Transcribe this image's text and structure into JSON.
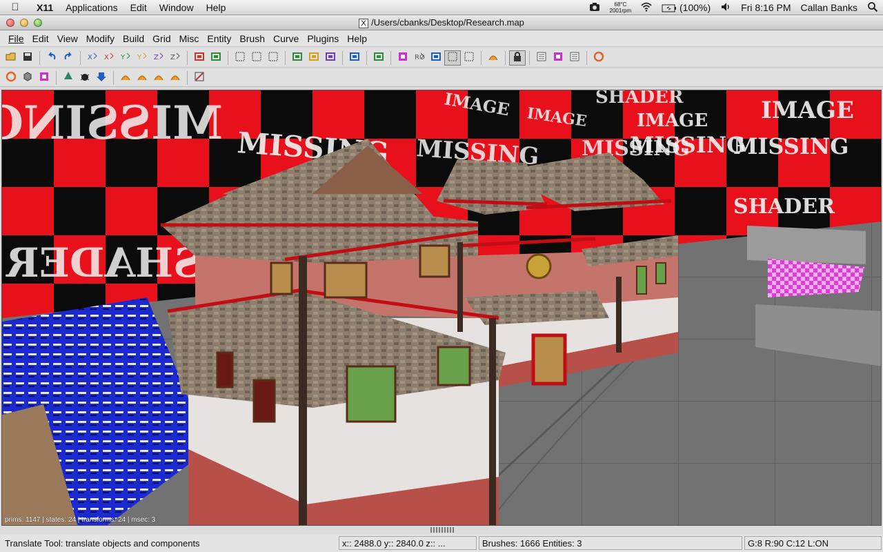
{
  "macos_menubar": {
    "app_name": "X11",
    "items": [
      "Applications",
      "Edit",
      "Window",
      "Help"
    ],
    "temperature": "68°C",
    "fan": "2001rpm",
    "battery": "(100%)",
    "clock": "Fri 8:16 PM",
    "user": "Callan Banks"
  },
  "window": {
    "title": "/Users/cbanks/Desktop/Research.map"
  },
  "menu": [
    {
      "label": "File"
    },
    {
      "label": "Edit"
    },
    {
      "label": "View"
    },
    {
      "label": "Modify"
    },
    {
      "label": "Build"
    },
    {
      "label": "Grid"
    },
    {
      "label": "Misc"
    },
    {
      "label": "Entity"
    },
    {
      "label": "Brush"
    },
    {
      "label": "Curve"
    },
    {
      "label": "Plugins"
    },
    {
      "label": "Help"
    }
  ],
  "toolbar1_icons": [
    "open-icon",
    "save-icon",
    "|",
    "undo-icon",
    "redo-icon",
    "|",
    "flip-x-icon",
    "rotate-x-icon",
    "flip-y-icon",
    "rotate-y-icon",
    "flip-z-icon",
    "rotate-z-icon",
    "|",
    "csg-subtract-icon",
    "csg-merge-icon",
    "|",
    "select-inside-icon",
    "select-touching-icon",
    "select-complete-icon",
    "|",
    "hollow-icon",
    "csg-make-room-icon",
    "clipper-green-icon",
    "|",
    "view-change-icon",
    "|",
    "clipper-icon",
    "|",
    "texture-lock-icon",
    "camera-rotate-icon",
    "scale-icon",
    "select-drag-icon",
    "resize-icon",
    "|",
    "patch-icon",
    "|",
    "lock-icon",
    "|",
    "entity-list-icon",
    "texture-browser-icon",
    "surface-inspector-icon",
    "|",
    "refresh-icon"
  ],
  "toolbar2_icons": [
    "refresh-models-icon",
    "cube-icon",
    "texture-icon",
    "|",
    "tree-icon",
    "bug-icon",
    "arrow-down-icon",
    "|",
    "patch-cap-icon",
    "patch-bevel-icon",
    "patch-cylinder-icon",
    "patch-endcap-icon",
    "|",
    "clear-selection-icon"
  ],
  "viewport": {
    "texture_text": [
      "SHADER",
      "IMAGE",
      "MISSING"
    ],
    "stats": "prims: 1147 | states: 24 | transforms: 24 | msec: 3"
  },
  "statusbar": {
    "message": "Translate Tool: translate objects and components",
    "coords": "x:: 2488.0  y:: 2840.0  z::   ...",
    "counts": "Brushes: 1666 Entities: 3",
    "grid": "G:8  R:90  C:12  L:ON"
  },
  "colors": {
    "shader_red": "#e8101a",
    "roof_brown": "#8d7e6e",
    "wall_pink": "#c4746a",
    "wall_white": "#e6e2df",
    "floor_gray": "#6f6f6f",
    "crate_blue": "#1a2ad0",
    "magenta": "#e23ad8"
  }
}
